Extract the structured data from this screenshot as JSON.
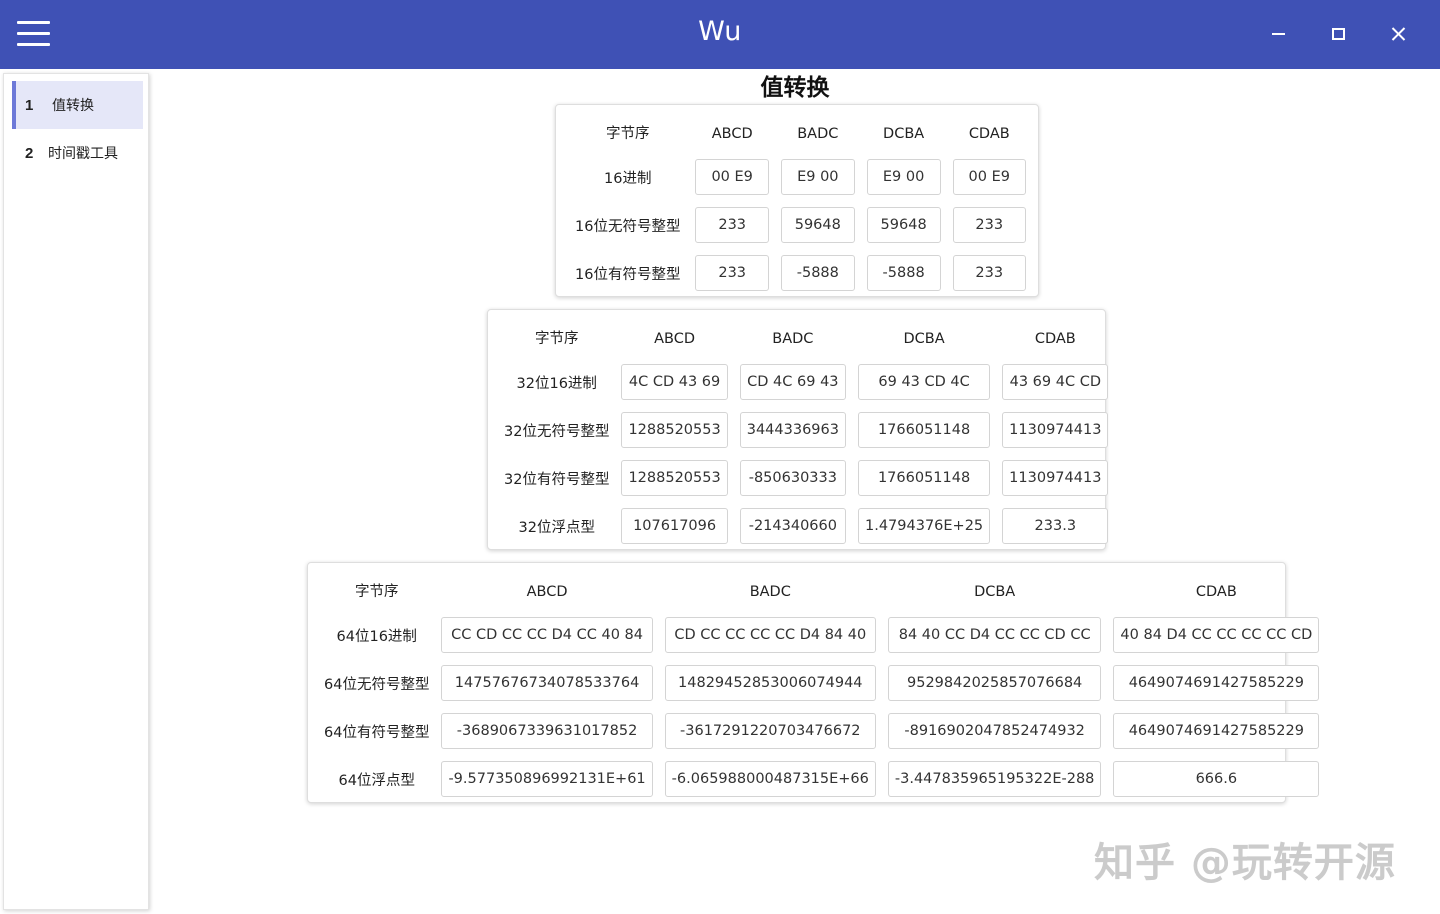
{
  "window": {
    "title": "Wu"
  },
  "sidebar": {
    "items": [
      {
        "num": "1",
        "label": "值转换",
        "active": true
      },
      {
        "num": "2",
        "label": "时间戳工具",
        "active": false
      }
    ]
  },
  "page": {
    "title": "值转换"
  },
  "card16": {
    "headers": [
      "字节序",
      "ABCD",
      "BADC",
      "DCBA",
      "CDAB"
    ],
    "rows": [
      {
        "label": "16进制",
        "values": [
          "00 E9",
          "E9 00",
          "E9 00",
          "00 E9"
        ]
      },
      {
        "label": "16位无符号整型",
        "values": [
          "233",
          "59648",
          "59648",
          "233"
        ]
      },
      {
        "label": "16位有符号整型",
        "values": [
          "233",
          "-5888",
          "-5888",
          "233"
        ]
      }
    ]
  },
  "card32": {
    "headers": [
      "字节序",
      "ABCD",
      "BADC",
      "DCBA",
      "CDAB"
    ],
    "rows": [
      {
        "label": "32位16进制",
        "values": [
          "4C CD 43 69",
          "CD 4C 69 43",
          "69 43 CD 4C",
          "43 69 4C CD"
        ]
      },
      {
        "label": "32位无符号整型",
        "values": [
          "1288520553",
          "3444336963",
          "1766051148",
          "1130974413"
        ]
      },
      {
        "label": "32位有符号整型",
        "values": [
          "1288520553",
          "-850630333",
          "1766051148",
          "1130974413"
        ]
      },
      {
        "label": "32位浮点型",
        "values": [
          "107617096",
          "-214340660",
          "1.4794376E+25",
          "233.3"
        ]
      }
    ]
  },
  "card64": {
    "headers": [
      "字节序",
      "ABCD",
      "BADC",
      "DCBA",
      "CDAB"
    ],
    "rows": [
      {
        "label": "64位16进制",
        "values": [
          "CC CD CC CC D4 CC 40 84",
          "CD CC CC CC CC D4 84 40",
          "84 40 CC D4 CC CC CD CC",
          "40 84 D4 CC CC CC CC CD"
        ]
      },
      {
        "label": "64位无符号整型",
        "values": [
          "14757676734078533764",
          "14829452853006074944",
          "9529842025857076684",
          "4649074691427585229"
        ]
      },
      {
        "label": "64位有符号整型",
        "values": [
          "-3689067339631017852",
          "-3617291220703476672",
          "-8916902047852474932",
          "4649074691427585229"
        ]
      },
      {
        "label": "64位浮点型",
        "values": [
          "-9.577350896992131E+61",
          "-6.065988000487315E+66",
          "-3.447835965195322E-288",
          "666.6"
        ]
      }
    ]
  },
  "watermark": {
    "text": "知乎 @玩转开源"
  },
  "colors": {
    "titlebar": "#3f51b5",
    "nav_active_bg": "#e5e7f8",
    "nav_active_border": "#6d79d8"
  }
}
